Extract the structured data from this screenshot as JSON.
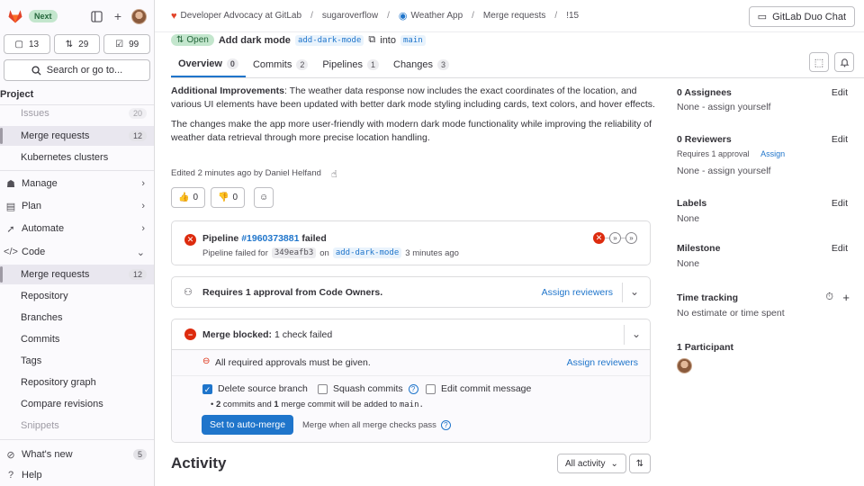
{
  "sidebar": {
    "next_badge": "Next",
    "counts": {
      "issues": "13",
      "merge_requests": "29",
      "todos": "99"
    },
    "search_label": "Search or go to...",
    "heading": "Project",
    "items": [
      {
        "label": "Issues",
        "badge": "20"
      },
      {
        "label": "Merge requests",
        "badge": "12"
      },
      {
        "label": "Kubernetes clusters"
      },
      {
        "label": "Manage"
      },
      {
        "label": "Plan"
      },
      {
        "label": "Automate"
      },
      {
        "label": "Code"
      },
      {
        "label": "Merge requests",
        "badge": "12"
      },
      {
        "label": "Repository"
      },
      {
        "label": "Branches"
      },
      {
        "label": "Commits"
      },
      {
        "label": "Tags"
      },
      {
        "label": "Repository graph"
      },
      {
        "label": "Compare revisions"
      },
      {
        "label": "Snippets"
      },
      {
        "label": "What's new",
        "badge": "5"
      },
      {
        "label": "Help"
      }
    ]
  },
  "breadcrumb": {
    "group": "Developer Advocacy at GitLab",
    "user": "sugaroverflow",
    "project": "Weather App",
    "section": "Merge requests",
    "mr": "!15"
  },
  "duo_button": "GitLab Duo Chat",
  "mr": {
    "status": "Open",
    "title": "Add dark mode",
    "source_branch": "add-dark-mode",
    "into": "into",
    "target_branch": "main"
  },
  "tabs": [
    {
      "label": "Overview",
      "count": "0"
    },
    {
      "label": "Commits",
      "count": "2"
    },
    {
      "label": "Pipelines",
      "count": "1"
    },
    {
      "label": "Changes",
      "count": "3"
    }
  ],
  "description": {
    "p1_bold": "Additional Improvements",
    "p1_rest": ": The weather data response now includes the exact coordinates of the location, and various UI elements have been updated with better dark mode styling including cards, text colors, and hover effects.",
    "p2": "The changes make the app more user-friendly with modern dark mode functionality while improving the reliability of weather data retrieval through more precise location handling.",
    "edited_prefix": "Edited 2 minutes ago by",
    "edited_by": "Daniel Helfand"
  },
  "reactions": {
    "thumbsup": "0",
    "thumbsdown": "0"
  },
  "pipeline": {
    "prefix": "Pipeline",
    "id": "#1960373881",
    "status": "failed",
    "detail_prefix": "Pipeline failed for",
    "commit": "349eafb3",
    "on": "on",
    "branch": "add-dark-mode",
    "time": "3 minutes ago"
  },
  "approval": {
    "text": "Requires 1 approval from Code Owners.",
    "action": "Assign reviewers"
  },
  "merge": {
    "blocked_bold": "Merge blocked:",
    "blocked_rest": "1 check failed",
    "check_text": "All required approvals must be given.",
    "check_action": "Assign reviewers",
    "opt_delete": "Delete source branch",
    "opt_squash": "Squash commits",
    "opt_edit": "Edit commit message",
    "summary_a": "2",
    "summary_b": "commits and",
    "summary_c": "1",
    "summary_d": "merge commit will be added to",
    "summary_branch": "main.",
    "button": "Set to auto-merge",
    "hint": "Merge when all merge checks pass"
  },
  "activity": {
    "title": "Activity",
    "filter": "All activity"
  },
  "right_sidebar": {
    "assignees_title": "0 Assignees",
    "assignees_edit": "Edit",
    "assignees_val": "None - assign yourself",
    "reviewers_title": "0 Reviewers",
    "reviewers_edit": "Edit",
    "reviewers_req": "Requires 1 approval",
    "reviewers_assign": "Assign",
    "reviewers_val": "None - assign yourself",
    "labels_title": "Labels",
    "labels_edit": "Edit",
    "labels_val": "None",
    "milestone_title": "Milestone",
    "milestone_edit": "Edit",
    "milestone_val": "None",
    "time_title": "Time tracking",
    "time_val": "No estimate or time spent",
    "participants_title": "1 Participant"
  },
  "colors": {
    "accent": "#1f75cb",
    "danger": "#dd2b0e",
    "success_bg": "#c3e6cd",
    "brand": "#e24329"
  }
}
